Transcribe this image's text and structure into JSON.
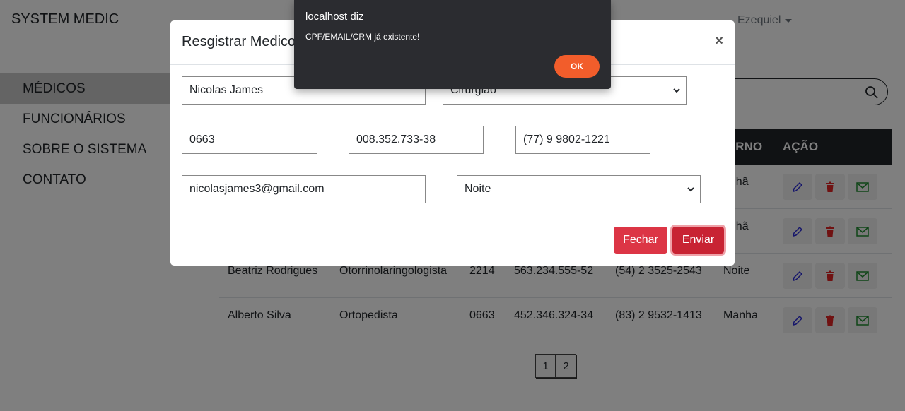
{
  "app": {
    "brand": "SYSTEM MEDIC",
    "user": "Ezequiel"
  },
  "sidebar": {
    "items": [
      {
        "label": "MÉDICOS"
      },
      {
        "label": "FUNCIONÁRIOS"
      },
      {
        "label": "SOBRE O SISTEMA"
      },
      {
        "label": "CONTATO"
      }
    ]
  },
  "table": {
    "headers": {
      "turno": "URNO",
      "acao": "AÇÃO"
    },
    "rows": [
      {
        "nome": "",
        "especialidade": "",
        "crm": "",
        "cpf": "",
        "telefone": "",
        "turno": "anhã"
      },
      {
        "nome": "",
        "especialidade": "",
        "crm": "",
        "cpf": "",
        "telefone": "",
        "turno": "anhã"
      },
      {
        "nome": "Beatriz Rodrigues",
        "especialidade": "Otorrinolaringologista",
        "crm": "2214",
        "cpf": "563.234.555-52",
        "telefone": "(54) 2 3525-2543",
        "turno": "Noite"
      },
      {
        "nome": "Alberto Silva",
        "especialidade": "Ortopedista",
        "crm": "0663",
        "cpf": "452.346.324-34",
        "telefone": "(83) 2 9532-1413",
        "turno": "Manha"
      }
    ]
  },
  "pagination": {
    "pages": [
      "1",
      "2"
    ]
  },
  "modal": {
    "title": "Resgistrar Medico",
    "close_symbol": "×",
    "fields": {
      "nome": "Nicolas James",
      "especialidade": "Cirurgião",
      "crm": "0663",
      "cpf": "008.352.733-38",
      "telefone": "(77) 9 9802-1221",
      "email": "nicolasjames3@gmail.com",
      "turno": "Noite"
    },
    "buttons": {
      "fechar": "Fechar",
      "enviar": "Enviar"
    }
  },
  "alert": {
    "title": "localhost diz",
    "message": "CPF/EMAIL/CRM já existente!",
    "ok": "OK"
  },
  "colors": {
    "danger": "#dc3545",
    "alert_ok": "#f25d2b",
    "table_header": "#212529"
  }
}
